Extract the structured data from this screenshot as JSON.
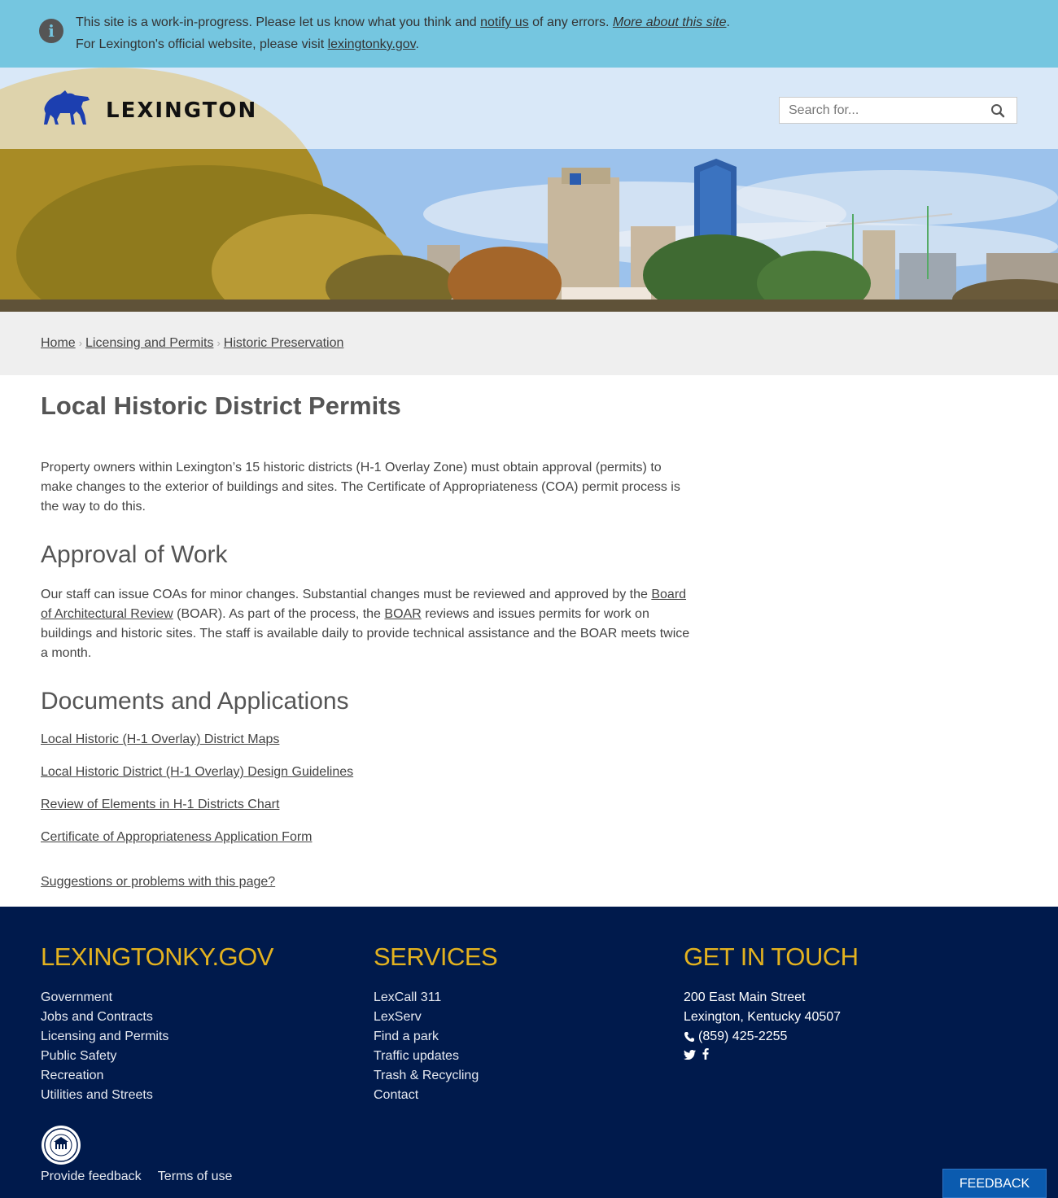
{
  "alert": {
    "line1_prefix": "This site is a work-in-progress. Please let us know what you think and ",
    "notify_link": "notify us",
    "line1_middle": " of any errors. ",
    "more_link": "More about this site",
    "line1_suffix": ".",
    "line2_prefix": "For Lexington's official website, please visit ",
    "gov_link": "lexingtonky.gov",
    "line2_suffix": ".",
    "icon": "info-icon"
  },
  "header": {
    "logo_text": "LEXINGTON",
    "logo_icon": "horse-icon",
    "search_placeholder": "Search for...",
    "brand_color": "#1c3fb0"
  },
  "breadcrumb": {
    "items": [
      "Home",
      "Licensing and Permits",
      "Historic Preservation"
    ],
    "separator": "›"
  },
  "main": {
    "title": "Local Historic District Permits",
    "intro": "Property owners within Lexington’s 15 historic districts (H-1 Overlay Zone) must obtain approval (permits) to make changes to the exterior of buildings and sites. The Certificate of Appropriateness (COA) permit process is the way to do this.",
    "approval": {
      "heading": "Approval of Work",
      "text1": "Our staff can issue COAs for minor changes. Substantial changes must be reviewed and approved by the ",
      "link1": "Board of Architectural Review",
      "text2": " (BOAR). As part of the process, the ",
      "link2": "BOAR",
      "text3": " reviews and issues permits for work on buildings and historic sites. The staff is available daily to provide technical assistance and the BOAR meets twice a month."
    },
    "documents": {
      "heading": "Documents and Applications",
      "links": [
        "Local Historic (H-1 Overlay) District Maps",
        "Local Historic District (H-1 Overlay) Design Guidelines",
        "Review of Elements in H-1 Districts Chart",
        "Certificate of Appropriateness Application Form"
      ]
    },
    "suggest_link": "Suggestions or problems with this page?"
  },
  "footer": {
    "col1": {
      "heading": "LEXINGTONKY.GOV",
      "links": [
        "Government",
        "Jobs and Contracts",
        "Licensing and Permits",
        "Public Safety",
        "Recreation",
        "Utilities and Streets"
      ]
    },
    "col2": {
      "heading": "SERVICES",
      "links": [
        "LexCall 311",
        "LexServ",
        "Find a park",
        "Traffic updates",
        "Trash & Recycling",
        "Contact"
      ]
    },
    "col3": {
      "heading": "GET IN TOUCH",
      "address1": "200 East Main Street",
      "address2": "Lexington, Kentucky 40507",
      "phone": "(859) 425-2255",
      "phone_icon": "phone-icon",
      "social_icons": [
        "twitter-icon",
        "facebook-icon"
      ]
    },
    "bottom_links": [
      "Provide feedback",
      "Terms of use"
    ],
    "feedback_button": "FEEDBACK",
    "heading_color": "#e3b21f",
    "background_color": "#001a4c"
  }
}
